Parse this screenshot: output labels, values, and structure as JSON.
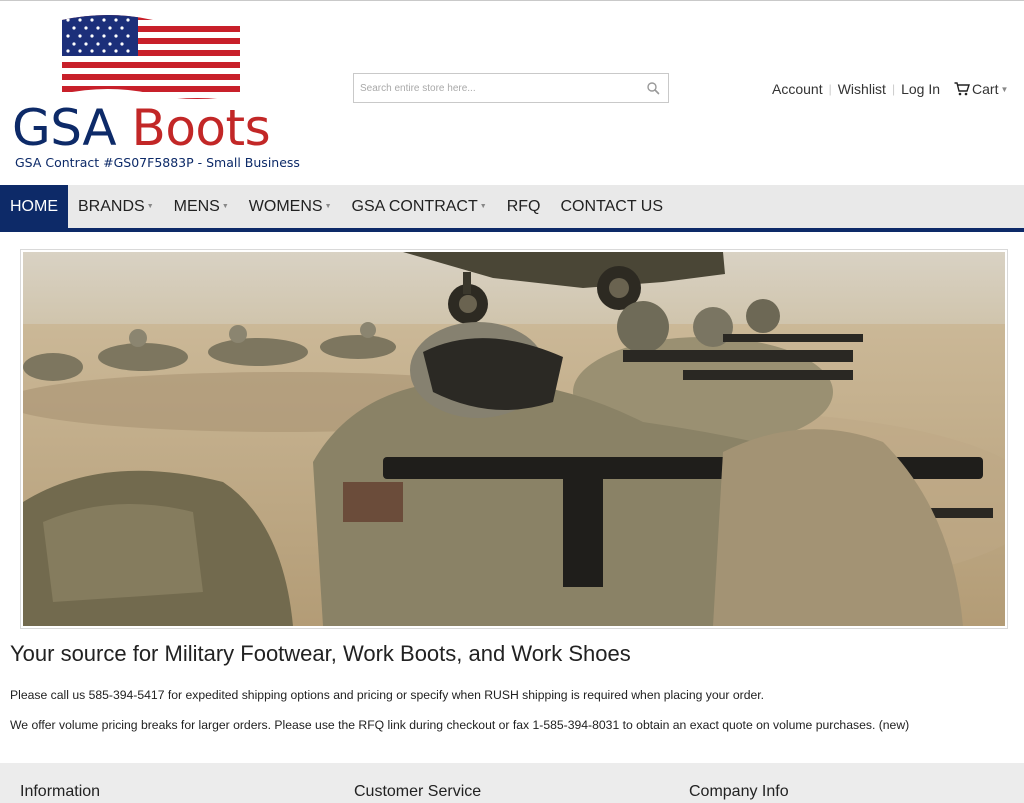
{
  "header": {
    "brand_part1": "GSA",
    "brand_part2": "Boots",
    "contract_line": "GSA Contract #GS07F5883P - Small Business",
    "search_placeholder": "Search entire store here...",
    "links": {
      "account": "Account",
      "wishlist": "Wishlist",
      "login": "Log In",
      "cart": "Cart"
    }
  },
  "nav": {
    "items": [
      {
        "label": "HOME",
        "active": true,
        "dropdown": false
      },
      {
        "label": "BRANDS",
        "active": false,
        "dropdown": true
      },
      {
        "label": "MENS",
        "active": false,
        "dropdown": true
      },
      {
        "label": "WOMENS",
        "active": false,
        "dropdown": true
      },
      {
        "label": "GSA CONTRACT",
        "active": false,
        "dropdown": true
      },
      {
        "label": "RFQ",
        "active": false,
        "dropdown": false
      },
      {
        "label": "CONTACT US",
        "active": false,
        "dropdown": false
      }
    ]
  },
  "main": {
    "headline": "Your source for Military Footwear, Work Boots, and Work Shoes",
    "paragraph1": "Please call us 585-394-5417 for expedited shipping options and pricing or specify when RUSH shipping is required when placing your order.",
    "paragraph2": "We offer volume pricing breaks for larger orders. Please use the RFQ link during checkout or fax 1-585-394-8031 to obtain an exact quote on volume purchases. (new)"
  },
  "footer": {
    "col1": "Information",
    "col2": "Customer Service",
    "col3": "Company Info"
  },
  "colors": {
    "brand_navy": "#0d2a68",
    "brand_red": "#c22727",
    "nav_bg": "#e9e9e9"
  },
  "icons": {
    "search": "magnifier-icon",
    "cart": "shopping-cart-icon",
    "dropdown": "caret-down-icon"
  }
}
